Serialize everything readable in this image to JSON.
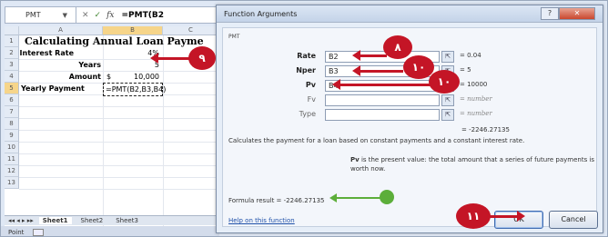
{
  "excel": {
    "name_box": "PMT",
    "formula_text": "=PMT(B2",
    "columns": [
      "A",
      "B",
      "C"
    ],
    "rows": [
      "1",
      "2",
      "3",
      "4",
      "5",
      "6",
      "7",
      "8",
      "9",
      "10",
      "11",
      "12",
      "13"
    ],
    "title": "Calculating Annual Loan Payme",
    "labels": {
      "interest": "Interest Rate",
      "years": "Years",
      "amount": "Amount",
      "payment": "Yearly Payment"
    },
    "values": {
      "interest": "4%",
      "years": "5",
      "amount_currency": "$",
      "amount": "10,000",
      "payment": "=PMT(B2,B3,B4)"
    },
    "sheet_tabs": [
      "Sheet1",
      "Sheet2",
      "Sheet3"
    ],
    "status_mode": "Point"
  },
  "dialog": {
    "title": "Function Arguments",
    "function_name": "PMT",
    "args": [
      {
        "label": "Rate",
        "value": "B2",
        "result": "= 0.04"
      },
      {
        "label": "Nper",
        "value": "B3",
        "result": "= 5"
      },
      {
        "label": "Pv",
        "value": "B4",
        "result": "= 10000"
      },
      {
        "label": "Fv",
        "value": "",
        "result": "= number"
      },
      {
        "label": "Type",
        "value": "",
        "result": "= number"
      }
    ],
    "formula_preview": "= -2246.27135",
    "description": "Calculates the payment for a loan based on constant payments and a constant interest rate.",
    "param_name": "Pv",
    "param_description": "is the present value: the total amount that a series of future payments is worth now.",
    "formula_result": "Formula result = -2246.27135",
    "help_link": "Help on this function",
    "ok": "OK",
    "cancel": "Cancel"
  },
  "callouts": {
    "c9": "٩",
    "c8": "٨",
    "c10a": "١٠",
    "c10b": "١٠",
    "c11": "١١"
  },
  "colors": {
    "callout_red": "#c41526",
    "green_pointer": "#5cae3a",
    "selected_header": "#f6d58a"
  },
  "icons": {
    "collapse": "collapse-dialog-icon",
    "cancel_x": "cancel-entry-icon",
    "enter_check": "enter-check-icon",
    "fx": "fx-icon"
  }
}
